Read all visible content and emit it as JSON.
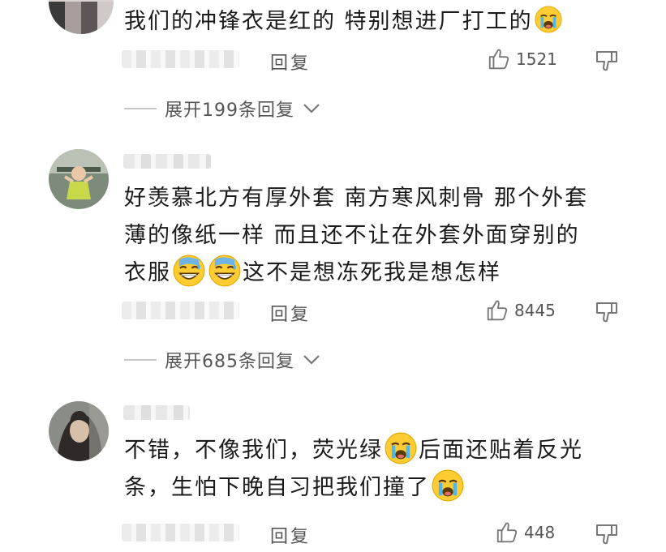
{
  "comments": [
    {
      "text": "我们的冲锋衣是红的 特别想进厂打工的",
      "emoji_after": [
        "crying-face"
      ],
      "reply_label": "回复",
      "likes": "1521",
      "expand_label": "展开199条回复"
    },
    {
      "line1": "好羡慕北方有厚外套 南方寒风刺骨 那个外套",
      "line2": "薄的像纸一样 而且还不让在外套外面穿别的",
      "line3_a": "衣服",
      "line3_b": "这不是想冻死我是想怎样",
      "emoji_mid": [
        "grinning-sweat-face",
        "grinning-sweat-face"
      ],
      "reply_label": "回复",
      "likes": "8445",
      "expand_label": "展开685条回复"
    },
    {
      "line1_a": "不错，不像我们，荧光绿",
      "line1_b": "后面还贴着反光",
      "line2_a": "条，生怕下晚自习把我们撞了",
      "emoji_mid": [
        "crying-face"
      ],
      "emoji_end": [
        "crying-face"
      ],
      "reply_label": "回复",
      "likes": "448"
    }
  ],
  "colors": {
    "text": "#1b1b1b",
    "meta": "#555555",
    "emoji_yellow": "#ffcc33"
  }
}
